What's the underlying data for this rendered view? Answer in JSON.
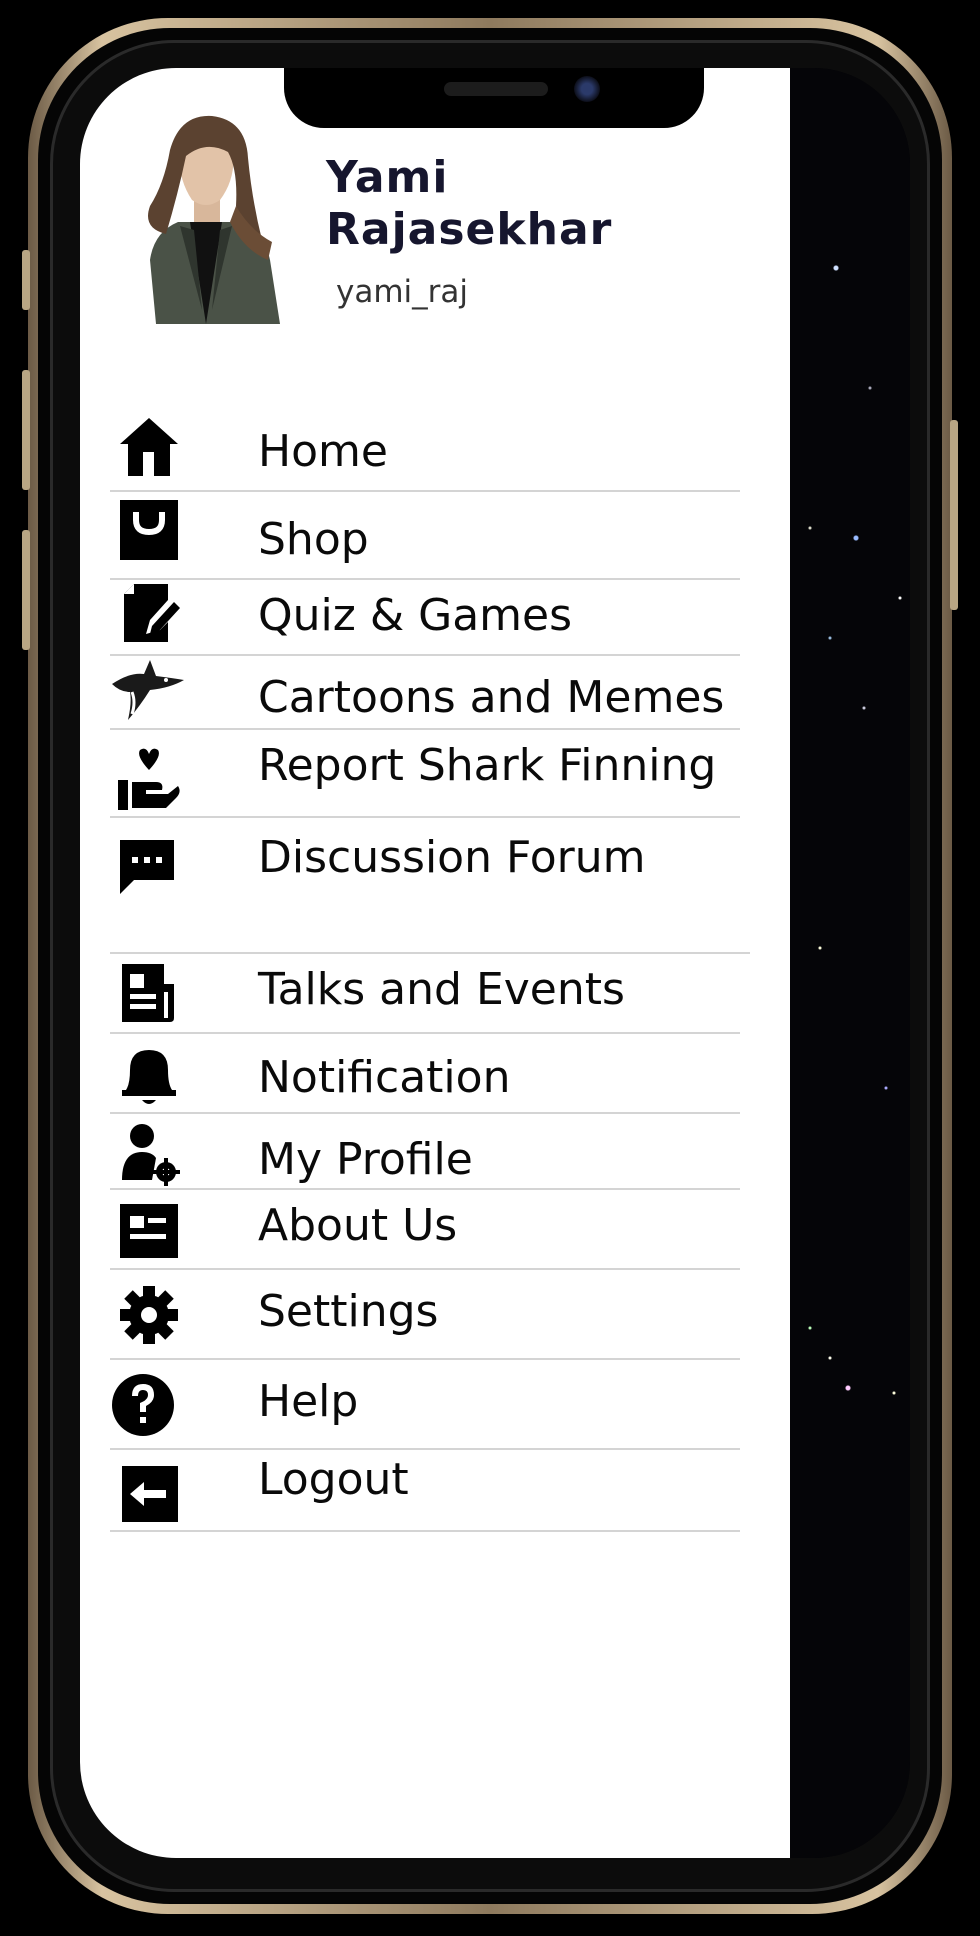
{
  "profile": {
    "name": "Yami Rajasekhar",
    "username": "yami_raj"
  },
  "menu": [
    {
      "label": "Home",
      "icon": "home-icon"
    },
    {
      "label": "Shop",
      "icon": "shopping-bag-icon"
    },
    {
      "label": "Quiz & Games",
      "icon": "quiz-edit-icon"
    },
    {
      "label": "Cartoons and Memes",
      "icon": "shark-icon"
    },
    {
      "label": "Report Shark Finning",
      "icon": "hand-heart-icon"
    },
    {
      "label": "Discussion Forum",
      "icon": "chat-bubble-icon"
    },
    {
      "label": "Talks and Events",
      "icon": "newspaper-icon"
    },
    {
      "label": "Notification",
      "icon": "bell-icon"
    },
    {
      "label": "My Profile",
      "icon": "user-settings-icon"
    },
    {
      "label": "About Us",
      "icon": "id-card-icon"
    },
    {
      "label": "Settings",
      "icon": "gear-icon"
    },
    {
      "label": "Help",
      "icon": "help-circle-icon"
    },
    {
      "label": "Logout",
      "icon": "logout-icon"
    }
  ],
  "colors": {
    "drawer_bg": "#ffffff",
    "name_text": "#16162e",
    "divider": "#d4d4d4",
    "frame_gold": "#d8c3a0"
  }
}
